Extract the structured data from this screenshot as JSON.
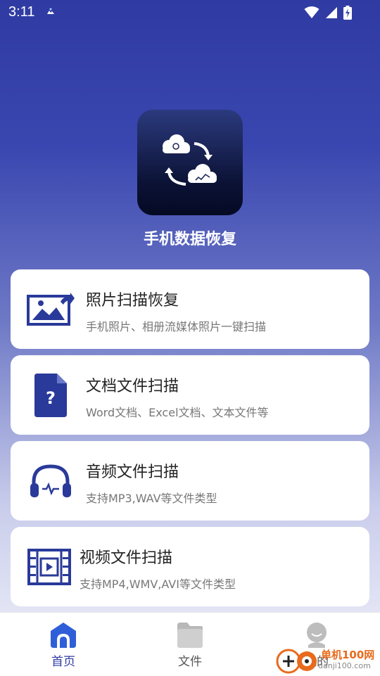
{
  "status_bar": {
    "time": "3:11"
  },
  "app": {
    "title": "手机数据恢复"
  },
  "cards": [
    {
      "title": "照片扫描恢复",
      "desc": "手机照片、相册流媒体照片一键扫描",
      "icon": "photo-icon"
    },
    {
      "title": "文档文件扫描",
      "desc": "Word文档、Excel文档、文本文件等",
      "icon": "document-icon"
    },
    {
      "title": "音频文件扫描",
      "desc": "支持MP3,WAV等文件类型",
      "icon": "headphones-icon"
    },
    {
      "title": "视频文件扫描",
      "desc": "支持MP4,WMV,AVI等文件类型",
      "icon": "video-icon"
    }
  ],
  "tabs": [
    {
      "label": "首页",
      "active": true
    },
    {
      "label": "文件",
      "active": false
    },
    {
      "label": "我的",
      "active": false
    }
  ],
  "watermark": {
    "text": "单机100网",
    "url": "danji100.com"
  },
  "colors": {
    "accent": "#2f3ba2",
    "card_icon": "#2a3a9a",
    "inactive": "#555555"
  }
}
